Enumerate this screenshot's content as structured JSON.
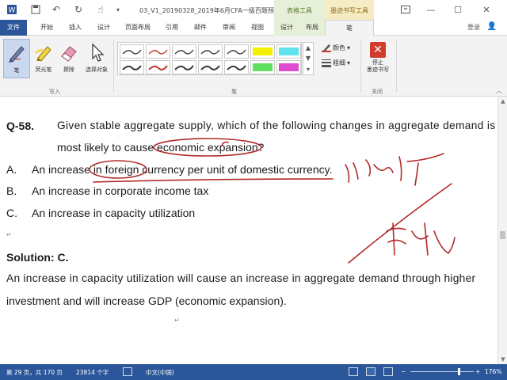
{
  "titlebar": {
    "title": "03_V1_20190328_2019年6月CFA一级百题预...",
    "context_tab_groups": [
      "表格工具",
      "墨迹书写工具"
    ]
  },
  "tabs": [
    "文件",
    "开始",
    "插入",
    "设计",
    "页面布局",
    "引用",
    "邮件",
    "审阅",
    "视图",
    "设计",
    "布局",
    "笔"
  ],
  "active_tab": "笔",
  "account": {
    "login_label": "登录"
  },
  "ribbon": {
    "tools": [
      "笔",
      "荧光笔",
      "擦除",
      "选择对象"
    ],
    "group_write_label": "写入",
    "group_pens_label": "笔",
    "group_close_label": "关闭",
    "color_label": "颜色",
    "weight_label": "粗细",
    "stop_label_line1": "停止",
    "stop_label_line2": "墨迹书写",
    "pen_colors": [
      "#3a3a3a",
      "#c0392b",
      "#3a3a3a",
      "#3a3a3a",
      "#3a3a3a",
      "#f2f000",
      "#5fe3ec",
      "#3a3a3a",
      "#c0392b",
      "#3a3a3a",
      "#3a3a3a",
      "#3a3a3a",
      "#5ee05e",
      "#e04ad0"
    ],
    "selected_color": "#c0392b"
  },
  "document": {
    "question_number": "Q-58.",
    "question_line1": "Given stable aggregate supply, which of the following changes in aggregate demand is",
    "question_line2": "most likely to cause economic expansion?",
    "options": [
      {
        "letter": "A.",
        "text": "An increase in foreign currency per unit of domestic currency."
      },
      {
        "letter": "B.",
        "text": "An increase in corporate income tax"
      },
      {
        "letter": "C.",
        "text": "An increase in capacity utilization"
      }
    ],
    "solution_heading": "Solution: C.",
    "solution_line1": "An increase in capacity utilization will cause an increase in aggregate demand through higher",
    "solution_line2": "investment and will increase GDP (economic expansion).",
    "paragraph_mark": "↵",
    "ink_color": "#b22a2a"
  },
  "statusbar": {
    "page": "第 29 页，共 170 页",
    "words": "23814 个字",
    "language": "中文(中国)",
    "zoom": "176%"
  }
}
